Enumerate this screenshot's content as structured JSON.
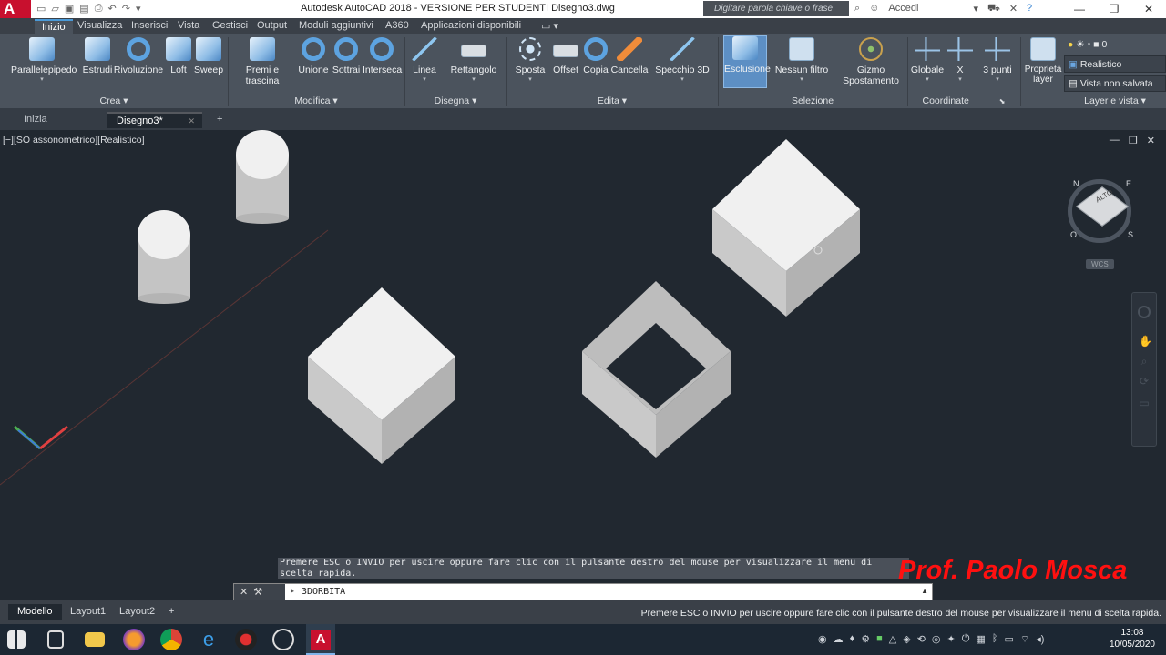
{
  "app": {
    "logo": "A",
    "title": "Autodesk AutoCAD 2018 - VERSIONE PER STUDENTI    Disegno3.dwg",
    "search_placeholder": "Digitare parola chiave o frase",
    "signin": "Accedi",
    "window_controls": [
      "—",
      "❐",
      "✕"
    ]
  },
  "ribbon_tabs": [
    "Inizio",
    "Visualizza",
    "Inserisci",
    "Vista",
    "Gestisci",
    "Output",
    "Moduli aggiuntivi",
    "A360",
    "Applicazioni disponibili"
  ],
  "ribbon": {
    "buttons": [
      {
        "label": "Parallelepipedo",
        "icon": "box-icon"
      },
      {
        "label": "Estrudi",
        "icon": "extrude-icon"
      },
      {
        "label": "Rivoluzione",
        "icon": "revolve-icon"
      },
      {
        "label": "Loft",
        "icon": "loft-icon"
      },
      {
        "label": "Sweep",
        "icon": "sweep-icon"
      },
      {
        "label": "Premi e trascina",
        "icon": "presspull-icon"
      },
      {
        "label": "Unione",
        "icon": "union-icon"
      },
      {
        "label": "Sottrai",
        "icon": "subtract-icon"
      },
      {
        "label": "Interseca",
        "icon": "intersect-icon"
      },
      {
        "label": "Linea",
        "icon": "line-icon"
      },
      {
        "label": "Rettangolo",
        "icon": "rectangle-icon"
      },
      {
        "label": "Sposta",
        "icon": "move-icon"
      },
      {
        "label": "Offset",
        "icon": "offset-icon"
      },
      {
        "label": "Copia",
        "icon": "copy-icon"
      },
      {
        "label": "Cancella",
        "icon": "erase-icon"
      },
      {
        "label": "Specchio 3D",
        "icon": "mirror3d-icon"
      },
      {
        "label": "Esclusione",
        "icon": "culling-icon"
      },
      {
        "label": "Nessun filtro",
        "icon": "filter-icon"
      },
      {
        "label": "Gizmo Spostamento",
        "icon": "gizmo-icon"
      },
      {
        "label": "Globale",
        "icon": "ucs-world-icon"
      },
      {
        "label": "X",
        "icon": "ucs-x-icon"
      },
      {
        "label": "3 punti",
        "icon": "ucs-3point-icon"
      },
      {
        "label": "Proprietà layer",
        "icon": "layer-properties-icon"
      }
    ],
    "panels": [
      "Crea",
      "Modifica",
      "Disegna",
      "Edita",
      "Selezione",
      "Coordinate",
      "Layer e vista"
    ],
    "layer_value": "0",
    "visual_style": "Realistico",
    "named_view": "Vista non salvata"
  },
  "doc_tabs": [
    "Inizia",
    "Disegno3*"
  ],
  "viewport": {
    "label": "[−][SO assonometrico][Realistico]",
    "viewcube": {
      "face": "ALTO",
      "n": "N",
      "e": "E",
      "s": "S",
      "o": "O",
      "wcs": "WCS"
    }
  },
  "command": {
    "history": "Premere ESC o INVIO per uscire oppure fare clic con il pulsante destro del mouse per visualizzare il menu di scelta rapida.",
    "input": "3DORBITA"
  },
  "watermark": "Prof. Paolo Mosca",
  "layout_tabs": [
    "Modello",
    "Layout1",
    "Layout2"
  ],
  "status_message": "Premere ESC o INVIO per uscire oppure fare clic con il pulsante destro del mouse per visualizzare il menu di scelta rapida.",
  "taskbar": {
    "time": "13:08",
    "date": "10/05/2020"
  },
  "colors": {
    "accent": "#c8102e",
    "viewport_bg": "#212830",
    "ribbon_bg": "#4b535d",
    "watermark": "#ff1010"
  }
}
